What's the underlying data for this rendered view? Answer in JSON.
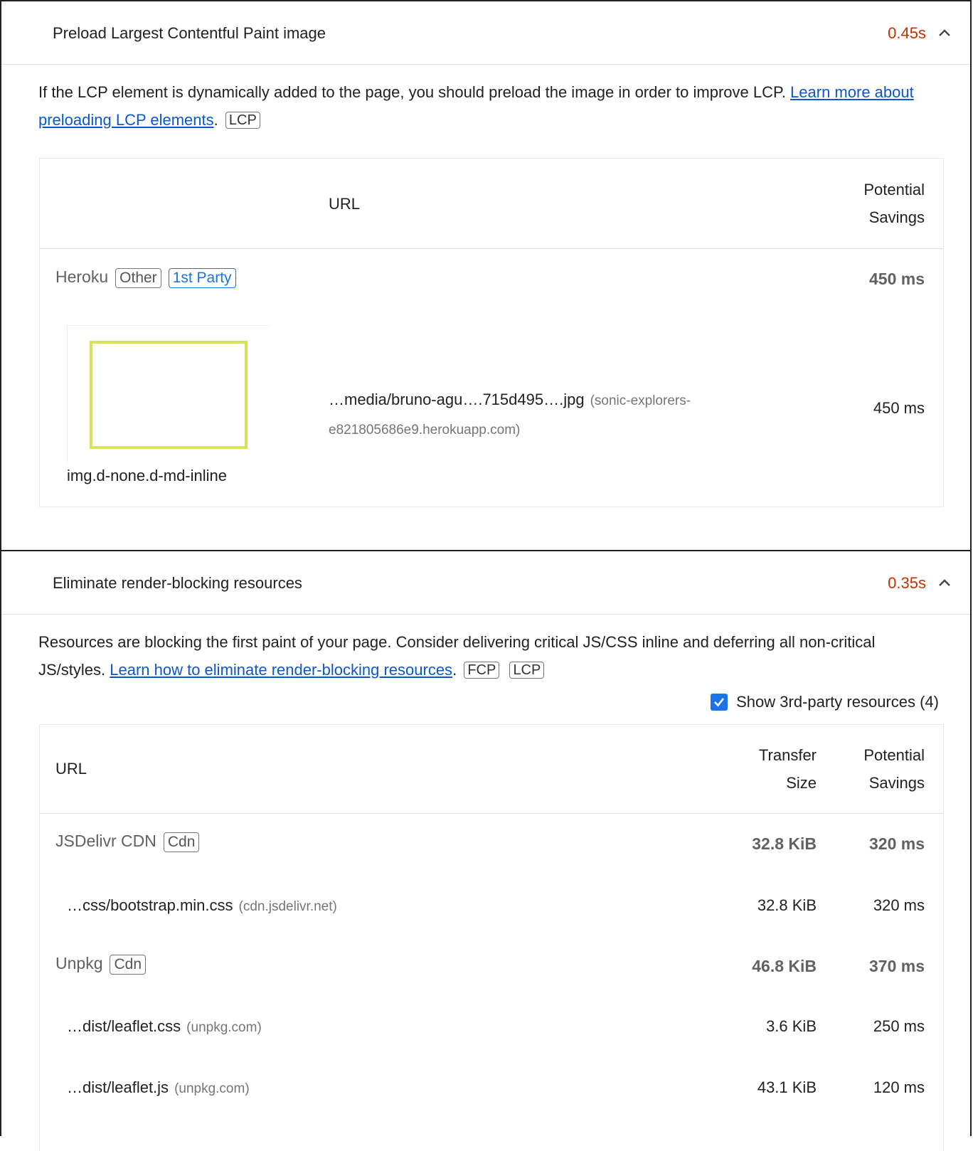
{
  "audit_lcp": {
    "title": "Preload Largest Contentful Paint image",
    "score": "0.45s",
    "desc_text": "If the LCP element is dynamically added to the page, you should preload the image in order to improve LCP. ",
    "desc_link": "Learn more about preloading LCP elements",
    "desc_period": ".",
    "tags": [
      "LCP"
    ],
    "table": {
      "headers": {
        "url": "URL",
        "savings_1": "Potential",
        "savings_2": "Savings"
      },
      "group": {
        "name": "Heroku",
        "badge_type": "Other",
        "badge_party": "1st Party",
        "savings": "450 ms"
      },
      "item": {
        "url": "…media/bruno-agu….715d495….jpg",
        "host_1": "(sonic-explorers-",
        "host_2": "e821805686e9.herokuapp.com)",
        "savings": "450 ms",
        "selector": "img.d-none.d-md-inline"
      }
    }
  },
  "audit_render": {
    "title": "Eliminate render-blocking resources",
    "score": "0.35s",
    "desc_text_1": "Resources are blocking the first paint of your page. Consider delivering critical JS/CSS inline and deferring all non-critical JS/styles. ",
    "desc_link": "Learn how to eliminate render-blocking resources",
    "desc_period": ".",
    "tags": [
      "FCP",
      "LCP"
    ],
    "third_party_label": "Show 3rd-party resources (4)",
    "table": {
      "headers": {
        "url": "URL",
        "size_1": "Transfer",
        "size_2": "Size",
        "savings_1": "Potential",
        "savings_2": "Savings"
      },
      "groups": [
        {
          "name": "JSDelivr CDN",
          "badge": "Cdn",
          "size": "32.8 KiB",
          "savings": "320 ms",
          "items": [
            {
              "url": "…css/bootstrap.min.css",
              "host": "(cdn.jsdelivr.net)",
              "size": "32.8 KiB",
              "savings": "320 ms"
            }
          ]
        },
        {
          "name": "Unpkg",
          "badge": "Cdn",
          "size": "46.8 KiB",
          "savings": "370 ms",
          "items": [
            {
              "url": "…dist/leaflet.css",
              "host": "(unpkg.com)",
              "size": "3.6 KiB",
              "savings": "250 ms"
            },
            {
              "url": "…dist/leaflet.js",
              "host": "(unpkg.com)",
              "size": "43.1 KiB",
              "savings": "120 ms"
            }
          ]
        }
      ]
    }
  },
  "colors": {
    "score_red": "#c33300",
    "link_blue": "#0b57d0",
    "checkbox_blue": "#1a73e8",
    "lcp_box": "#d6e35a"
  }
}
